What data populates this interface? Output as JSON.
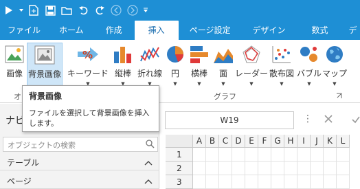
{
  "tabs": [
    "ファイル",
    "ホーム",
    "作成",
    "挿入",
    "ページ設定",
    "デザイン",
    "数式",
    "デ"
  ],
  "active_tab": "挿入",
  "ribbon": {
    "buttons": {
      "image": "画像",
      "background_image": "背景画像",
      "keyword": "キーワード",
      "vertical_bar": "縦棒",
      "line": "折れ線",
      "pie": "円",
      "horizontal_bar": "横棒",
      "area": "面",
      "radar": "レーダー",
      "scatter": "散布図",
      "bubble": "バブル",
      "map": "マップ"
    },
    "groups": {
      "object_truncated": "オブ",
      "graph": "グラフ"
    }
  },
  "tooltip": {
    "title": "背景画像",
    "body": "ファイルを選択して背景画像を挿入します。"
  },
  "nav": {
    "title_truncated": "ナビゲ",
    "search_placeholder": "オブジェクトの検索",
    "sections": [
      "テーブル",
      "ページ"
    ]
  },
  "formula_bar": {
    "name_box": "W19"
  },
  "grid": {
    "columns": [
      "A",
      "B",
      "C",
      "D",
      "E",
      "F",
      "G",
      "H",
      "I",
      "J",
      "K",
      "L"
    ],
    "rows": [
      "1",
      "2",
      "3"
    ]
  },
  "colors": {
    "accent": "#1e8fd5",
    "selected": "#cfe6f8"
  }
}
